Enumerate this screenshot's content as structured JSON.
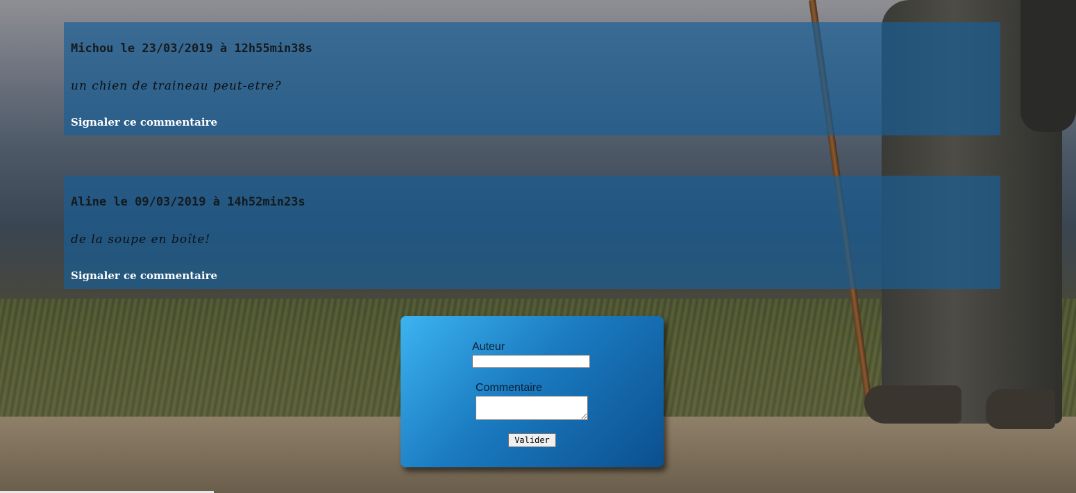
{
  "comments": [
    {
      "header": "Michou le 23/03/2019 à 12h55min38s",
      "text": "un chien de traineau peut-etre?",
      "report_label": "Signaler ce commentaire"
    },
    {
      "header": "Aline le 09/03/2019 à 14h52min23s",
      "text": "de la soupe en boîte!",
      "report_label": "Signaler ce commentaire"
    }
  ],
  "form": {
    "author_label": "Auteur",
    "author_value": "",
    "comment_label": "Commentaire",
    "comment_value": "",
    "submit_label": "Valider"
  },
  "colors": {
    "comment_panel": "#185f96",
    "form_gradient_start": "#3cb4f0",
    "form_gradient_end": "#0b4f8e"
  }
}
